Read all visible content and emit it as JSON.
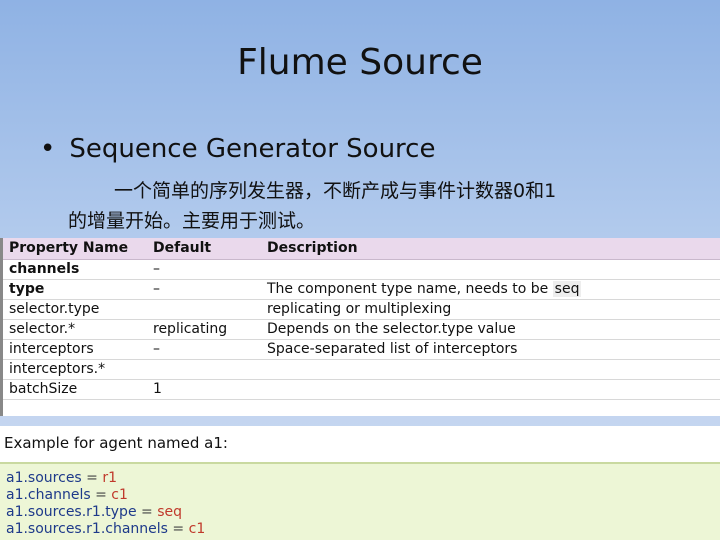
{
  "slide": {
    "title": "Flume Source",
    "bullet": "Sequence Generator Source",
    "description_line1": "一个简单的序列发生器，不断产成与事件计数器0和1",
    "description_line2": "的增量开始。主要用于测试。"
  },
  "table": {
    "headers": [
      "Property Name",
      "Default",
      "Description"
    ],
    "rows": [
      {
        "name": "channels",
        "default": "–",
        "description": "",
        "bold": true
      },
      {
        "name": "type",
        "default": "–",
        "description": "The component type name, needs to be",
        "code": "seq",
        "bold": true
      },
      {
        "name": "selector.type",
        "default": "",
        "description": "replicating or multiplexing",
        "bold": false
      },
      {
        "name": "selector.*",
        "default": "replicating",
        "description": "Depends on the selector.type value",
        "bold": false
      },
      {
        "name": "interceptors",
        "default": "–",
        "description": "Space-separated list of interceptors",
        "bold": false
      },
      {
        "name": "interceptors.*",
        "default": "",
        "description": "",
        "bold": false
      },
      {
        "name": "batchSize",
        "default": "1",
        "description": "",
        "bold": false
      }
    ]
  },
  "example": {
    "label": "Example for agent named a1:",
    "lines": [
      {
        "key": "a1.sources",
        "value": "r1"
      },
      {
        "key": "a1.channels",
        "value": "c1"
      },
      {
        "key": "a1.sources.r1.type",
        "value": "seq"
      },
      {
        "key": "a1.sources.r1.channels",
        "value": "c1"
      }
    ]
  }
}
